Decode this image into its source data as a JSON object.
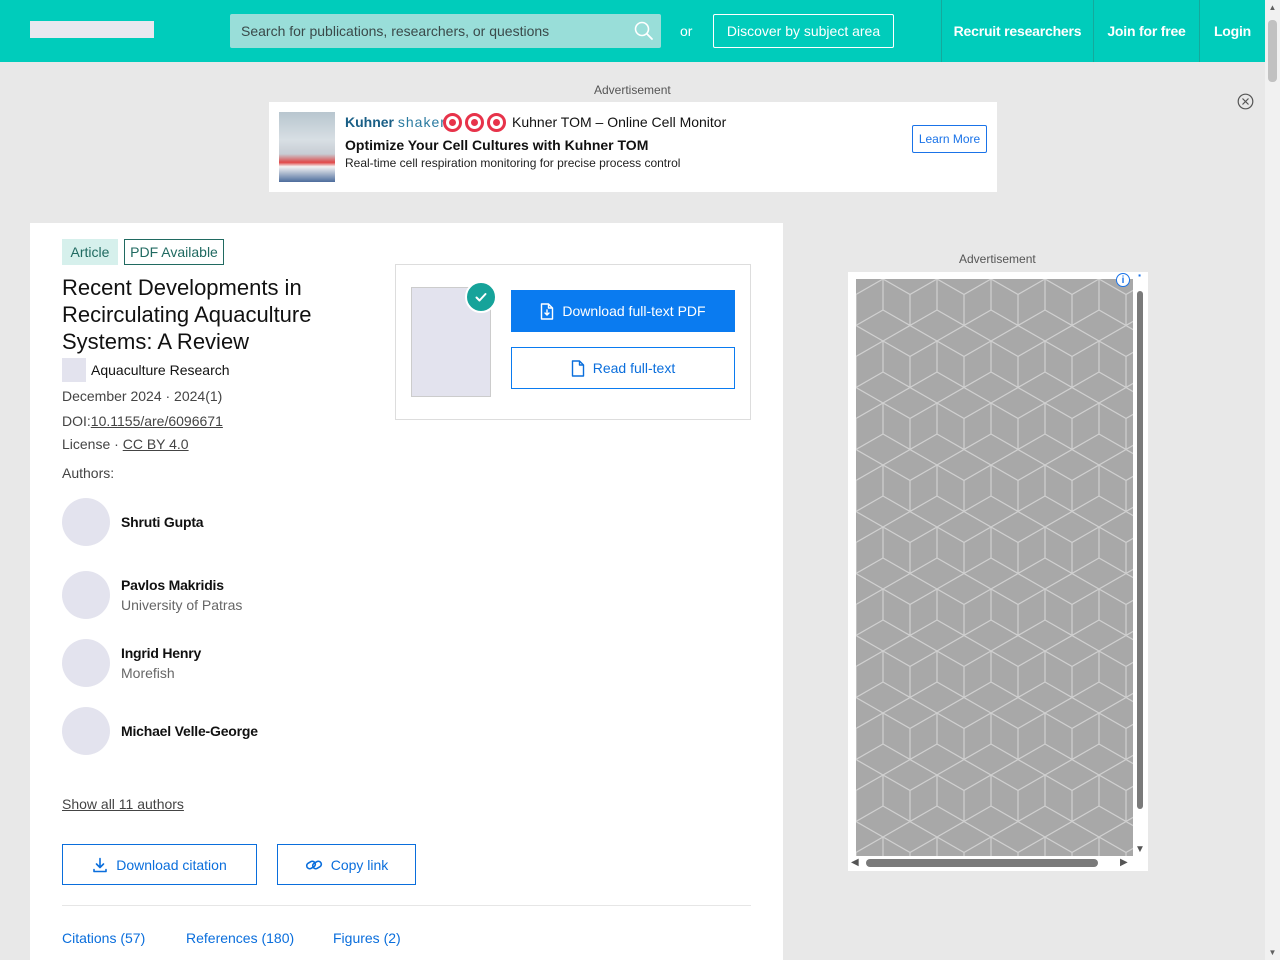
{
  "header": {
    "search_placeholder": "Search for publications, researchers, or questions",
    "or_text": "or",
    "discover_label": "Discover by subject area",
    "recruit_label": "Recruit researchers",
    "join_label": "Join for free",
    "login_label": "Login",
    "accent_color": "#00ccbb"
  },
  "ads": {
    "label": "Advertisement",
    "top": {
      "brand_bold": "Kuhner",
      "brand_light": "shaker",
      "product": "Kuhner TOM – Online Cell Monitor",
      "headline": "Optimize Your Cell Cultures with Kuhner TOM",
      "subtext": "Real-time cell respiration monitoring for precise process control",
      "cta": "Learn More"
    },
    "side": {
      "info_glyph": "i"
    }
  },
  "article": {
    "badge_type": "Article",
    "badge_pdf": "PDF Available",
    "title": "Recent Developments in Recirculating Aquaculture Systems: A Review",
    "journal": "Aquaculture Research",
    "date_line": "December 2024 · 2024(1)",
    "doi_label": "DOI:",
    "doi_value": "10.1155/are/6096671",
    "license_label": "License · ",
    "license_value": "CC BY 4.0",
    "authors_label": "Authors:",
    "authors": [
      {
        "name": "Shruti Gupta",
        "affiliation": ""
      },
      {
        "name": "Pavlos Makridis",
        "affiliation": "University of Patras"
      },
      {
        "name": "Ingrid Henry",
        "affiliation": "Morefish"
      },
      {
        "name": "Michael Velle-George",
        "affiliation": ""
      }
    ],
    "show_all": "Show all 11 authors",
    "download_citation": "Download citation",
    "copy_link": "Copy link",
    "tabs": [
      "Citations (57)",
      "References (180)",
      "Figures (2)"
    ]
  },
  "pdf_box": {
    "download_label": "Download full-text PDF",
    "read_label": "Read full-text"
  }
}
